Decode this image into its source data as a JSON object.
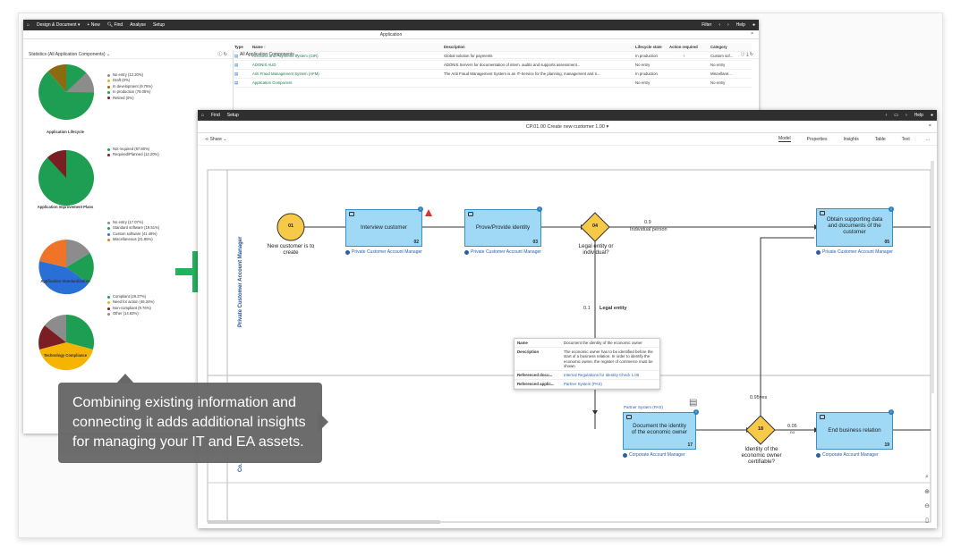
{
  "win1": {
    "menu": [
      "Design & Document ▾",
      "+ New",
      "Find",
      "Analyse",
      "Setup"
    ],
    "right": [
      "Filter",
      "Help"
    ],
    "title": "Application"
  },
  "stats": {
    "title": "Statistics (All Application Components)",
    "pies": [
      {
        "label": "Application Lifecycle",
        "legend": [
          "No entry (12.20%)",
          "Draft (0%)",
          "In development (9.76%)",
          "In production (78.05%)",
          "Retired (0%)"
        ]
      },
      {
        "label": "Application Improvement Plans",
        "legend": [
          "Not required (87.80%)",
          "Required/Planned (12.20%)"
        ]
      },
      {
        "label": "Application Standardization",
        "legend": [
          "No entry (17.07%)",
          "Standard software (19.51%)",
          "Custom software (41.46%)",
          "Miscellaneous (21.95%)"
        ]
      },
      {
        "label": "Technology Compliance",
        "legend": [
          "Compliant (29.27%)",
          "Need for action (46.34%)",
          "Non-compliant (9.76%)",
          "Other (14.63%)"
        ]
      }
    ]
  },
  "components": {
    "title": "All Application Components",
    "headers": [
      "Type",
      "Name ↑",
      "Description",
      "Lifecycle state",
      "Action required",
      "Category"
    ],
    "rows": [
      [
        "Accounts and Payments System (GIR)",
        "Global solution for payments",
        "In production",
        "!",
        "Custom sof..."
      ],
      [
        "ADONIS AUD",
        "ADONIS Servers for documentation of intern. audits and supports assessment...",
        "No entry",
        "",
        "No entry"
      ],
      [
        "Anti Fraud Management System (AFM)",
        "The Anti Fraud Management System is an IT-Service for the planning, management and ti...",
        "In production",
        "",
        "Miscellane..."
      ],
      [
        "Application Component",
        "",
        "No entry",
        "",
        "No entry"
      ]
    ]
  },
  "win2": {
    "menu": [
      "Find",
      "Setup"
    ],
    "right": [
      "Help"
    ],
    "title": "CP.01.00 Create new customer 1.00 ▾",
    "share": "Share",
    "tabs": [
      "Model",
      "Properties",
      "Insights",
      "Table",
      "Text",
      "..."
    ]
  },
  "lanes": {
    "top": "Private Customer Account Manager",
    "bottom": "Co..."
  },
  "diagram": {
    "start_num": "01",
    "start_text": "New customer is to create",
    "t02": "Interview customer",
    "t02n": "02",
    "t02role": "Private Customer Account Manager",
    "t03": "Prove/Provide identity",
    "t03n": "03",
    "t03role": "Private Customer Account Manager",
    "d04": "04",
    "d04text": "Legal entity or individual?",
    "f09": "0.9",
    "f09label": "Individual person",
    "f01": "0.1",
    "f01label": "Legal entity",
    "t05": "Obtain supporting data and documents of the customer",
    "t05n": "05",
    "t05role": "Private Customer Account Manager",
    "t17": "Document the identity of the economic owner",
    "t17n": "17",
    "t17role": "Corporate Account Manager",
    "t17pool": "Partner System (PAS)",
    "d18": "18",
    "d18text": "Identity of the economic owner certifiable?",
    "f095": "0.95yes",
    "f005": "0.05",
    "f005b": "no",
    "t19": "End business relation",
    "t19n": "19",
    "t19role": "Corporate Account Manager"
  },
  "tooltip": [
    [
      "Name",
      "Document the identity of the economic owner"
    ],
    [
      "Description",
      "The economic owner has to be identified before the start of a business relation. In order to identify the economic owner, the register of commerce must be shown"
    ],
    [
      "Referenced docu...",
      "Internal Regulations for Identity Check 1.00"
    ],
    [
      "Referenced applic...",
      "Partner System (PAS)"
    ]
  ],
  "callout": "Combining existing information and connecting it adds additional insights for managing your IT and EA assets.",
  "colors": {
    "green": "#1e9e53",
    "plus": "#22b35e",
    "orange": "#f07427",
    "yellow": "#f4b400",
    "darkred": "#7a1e24",
    "blue": "#2a6fd6",
    "gray": "#8c8c8c",
    "olive": "#8a6b12"
  }
}
